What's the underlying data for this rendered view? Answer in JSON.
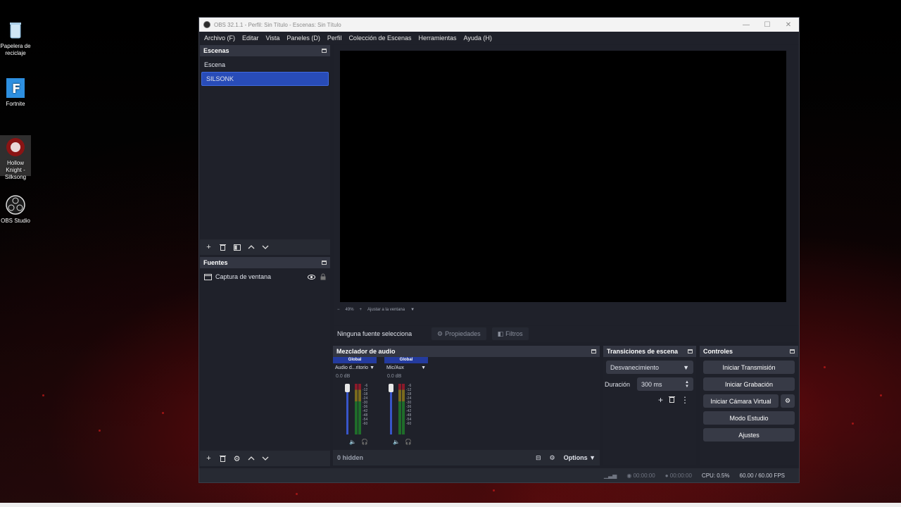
{
  "desktop": {
    "icons": [
      {
        "label_line1": "Papelera de",
        "label_line2": "reciclaje",
        "icon": "recycle-bin-icon"
      },
      {
        "label_line1": "Fortnite",
        "label_line2": "",
        "icon": "fortnite-icon"
      },
      {
        "label_line1": "Hollow Knight -",
        "label_line2": "Silksong",
        "icon": "silksong-icon"
      },
      {
        "label_line1": "OBS Studio",
        "label_line2": "",
        "icon": "obs-icon"
      }
    ]
  },
  "window": {
    "title": "OBS 32.1.1 - Perfil: Sin Título - Escenas: Sin Título",
    "controls": {
      "minimize": "—",
      "maximize": "☐",
      "close": "✕"
    }
  },
  "menu": [
    "Archivo (F)",
    "Editar",
    "Vista",
    "Paneles (D)",
    "Perfil",
    "Colección de Escenas",
    "Herramientas",
    "Ayuda (H)"
  ],
  "scenes": {
    "title": "Escenas",
    "items": [
      "Escena",
      "SILSONK"
    ],
    "selected": "SILSONK"
  },
  "sources": {
    "title": "Fuentes",
    "items": [
      {
        "label": "Captura de ventana"
      }
    ]
  },
  "preview": {
    "zoom": "49%",
    "fit_label": "Ajustar a la ventana"
  },
  "context": {
    "no_source": "Ninguna fuente seleccionada",
    "properties": "Propiedades",
    "filters": "Filtros"
  },
  "mixer": {
    "title": "Mezclador de audio",
    "channels": [
      {
        "head": "Global",
        "name": "Audio d...ritorio",
        "db": "0.0 dB",
        "level": 0.62
      },
      {
        "head": "Global",
        "name": "Mic/Aux",
        "db": "0.0 dB",
        "level": 0.3
      }
    ],
    "scale": [
      "-6",
      "-12",
      "-18",
      "-24",
      "-30",
      "-36",
      "-42",
      "-48",
      "-54",
      "-60"
    ],
    "hidden": "0 hidden",
    "options": "Options"
  },
  "transitions": {
    "title": "Transiciones de escena",
    "type": "Desvanecimiento",
    "duration_label": "Duración",
    "duration_value": "300 ms"
  },
  "controls": {
    "title": "Controles",
    "start_stream": "Iniciar Transmisión",
    "start_record": "Iniciar Grabación",
    "start_vcam": "Iniciar Cámara Virtual",
    "studio_mode": "Modo Estudio",
    "settings": "Ajustes"
  },
  "status": {
    "stream_time": "00:00:00",
    "record_time": "00:00:00",
    "cpu": "CPU: 0.5%",
    "fps": "60.00 / 60.00 FPS"
  },
  "colors": {
    "accent": "#284cb8",
    "panel": "#272a33",
    "bg": "#1f212a"
  }
}
